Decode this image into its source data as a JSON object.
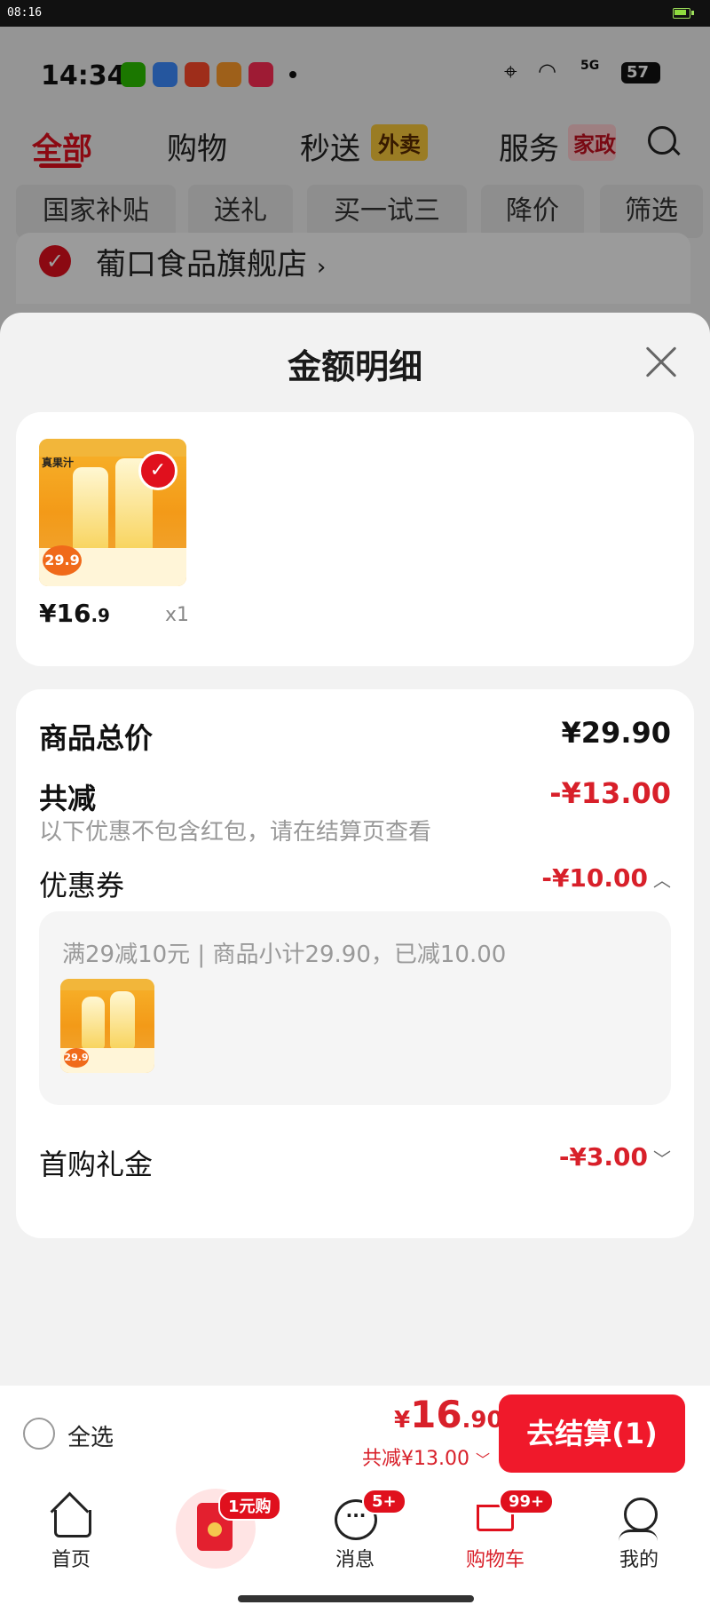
{
  "system_bar": {
    "time": "08:16"
  },
  "status_bar": {
    "time": "14:34",
    "network": "5G",
    "battery": "57"
  },
  "top_tabs": [
    {
      "label": "全部",
      "active": true
    },
    {
      "label": "购物",
      "active": false
    },
    {
      "label": "秒送",
      "active": false,
      "tag": "外卖"
    },
    {
      "label": "服务",
      "active": false,
      "tag": "家政"
    }
  ],
  "chips": [
    "国家补贴",
    "送礼",
    "买一试三",
    "降价",
    "筛选"
  ],
  "store": {
    "name": "葡口食品旗舰店",
    "arrow": "›"
  },
  "sheet": {
    "title": "金额明细",
    "product": {
      "price_int": "¥16",
      "price_dec": ".9",
      "quantity": "x1",
      "image_brand": "真果汁",
      "image_price": "29.9"
    },
    "details": {
      "total_label": "商品总价",
      "total_value": "¥29.90",
      "reduce_label": "共减",
      "reduce_value": "-¥13.00",
      "reduce_note": "以下优惠不包含红包，请在结算页查看",
      "coupon_label": "优惠券",
      "coupon_value": "-¥10.00",
      "coupon_desc": "满29减10元 | 商品小计29.90，已减10.00",
      "gift_label": "首购礼金",
      "gift_value": "-¥3.00"
    }
  },
  "checkout": {
    "select_all": "全选",
    "total_yen": "¥",
    "total_int": "16",
    "total_dec": ".90",
    "total_discount": "共减¥13.00",
    "pay_button": "去结算(1)"
  },
  "tabbar": {
    "home": "首页",
    "one_yuan_badge": "1元购",
    "messages": "消息",
    "messages_badge": "5+",
    "cart": "购物车",
    "cart_badge": "99+",
    "me": "我的"
  },
  "colors": {
    "accent": "#e0101d",
    "price_red": "#d8202a"
  }
}
